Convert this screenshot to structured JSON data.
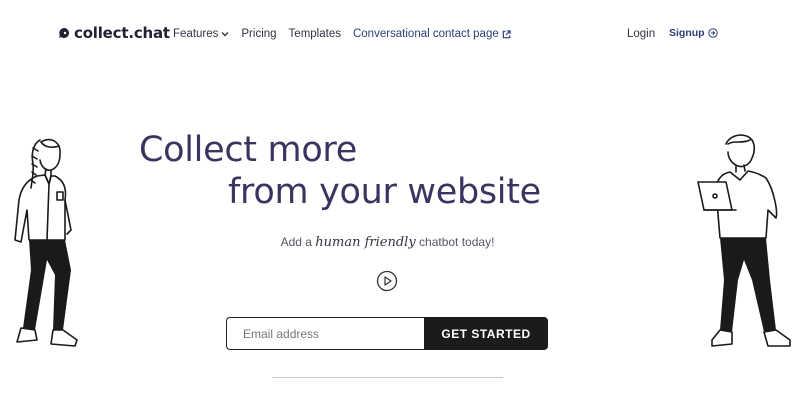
{
  "nav": {
    "brand": "collect.chat",
    "items": [
      {
        "label": "Features"
      },
      {
        "label": "Pricing"
      },
      {
        "label": "Templates"
      },
      {
        "label": "Conversational contact page"
      }
    ],
    "login": "Login",
    "signup": "Signup"
  },
  "hero": {
    "line1": "Collect more",
    "line2": "from your website",
    "tagline_pre": "Add a ",
    "tagline_script": "human friendly",
    "tagline_post": " chatbot today!"
  },
  "form": {
    "email_placeholder": "Email address",
    "cta": "GET STARTED"
  },
  "colors": {
    "heading": "#3a3560",
    "accent": "#2c3e7a",
    "cta_bg": "#1b1b1b"
  },
  "icons": [
    "chat-bubble-logo-icon",
    "chevron-down-icon",
    "external-link-icon",
    "sign-in-icon",
    "play-icon"
  ]
}
